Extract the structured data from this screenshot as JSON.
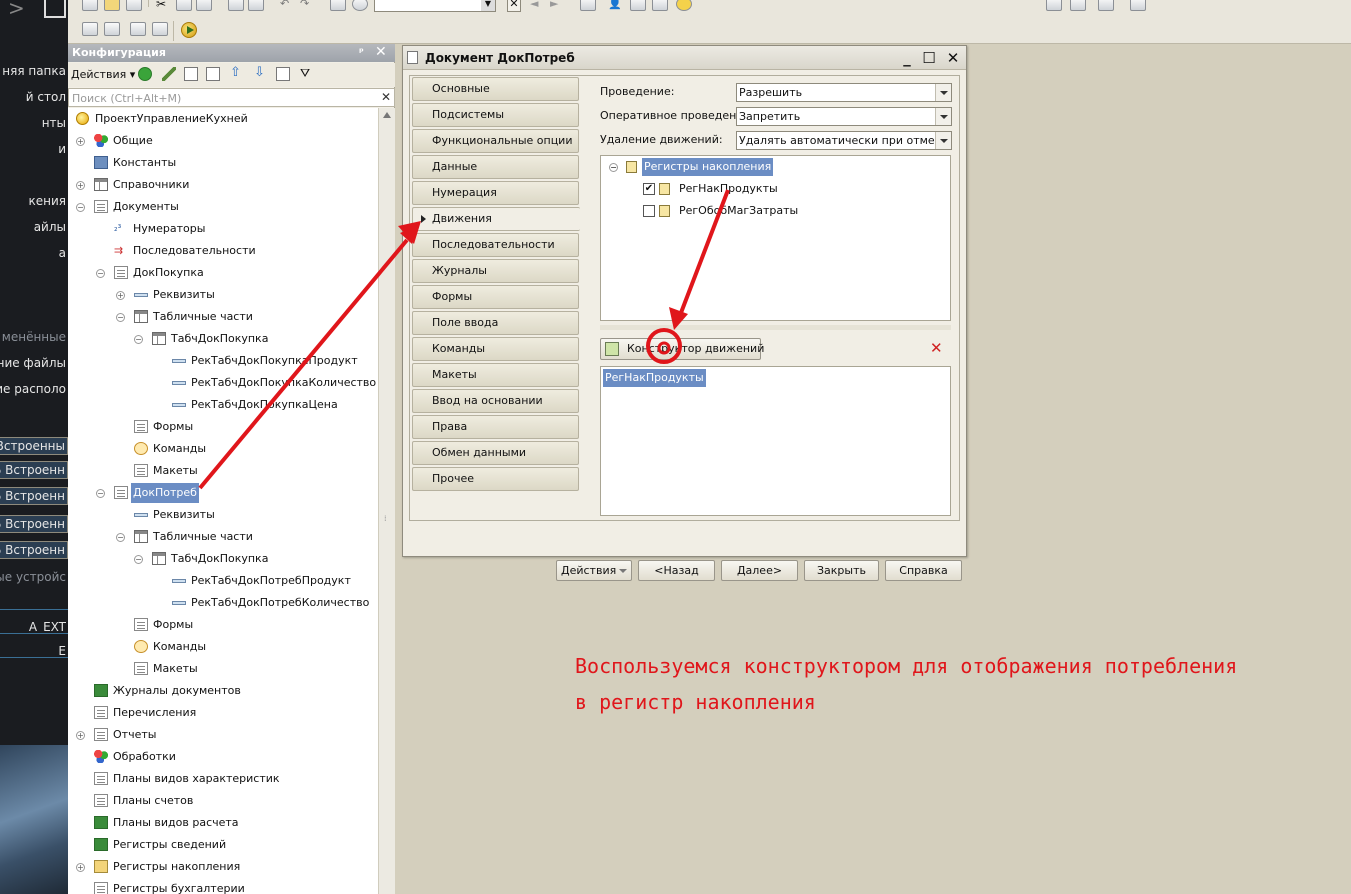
{
  "desktop": {
    "items": [
      {
        "text": "няя папка",
        "dim": false
      },
      {
        "text": "й стол",
        "dim": false
      },
      {
        "text": "нты",
        "dim": false
      },
      {
        "text": "и",
        "dim": false
      },
      {
        "text": "кения",
        "dim": false
      },
      {
        "text": "айлы",
        "dim": false
      },
      {
        "text": "а",
        "dim": false
      },
      {
        "text": "менённые",
        "dim": true
      },
      {
        "text": "ние файлы",
        "dim": false
      },
      {
        "text": "ние располо",
        "dim": false
      },
      {
        "text": "Встроенны",
        "dim": false
      },
      {
        "text": "Б Встроенн",
        "dim": false
      },
      {
        "text": "Б Встроенн",
        "dim": false
      },
      {
        "text": "Б Встроенн",
        "dim": false
      },
      {
        "text": "Б Встроенн",
        "dim": false
      },
      {
        "text": "ные устройс",
        "dim": true
      },
      {
        "text": "A_EXT",
        "dim": false
      },
      {
        "text": "E",
        "dim": false
      }
    ]
  },
  "config_panel": {
    "title": "Конфигурация",
    "actions_label": "Действия",
    "search_placeholder": "Поиск (Ctrl+Alt+M)",
    "tree": [
      "ПроектУправлениеКухней",
      "Общие",
      "Константы",
      "Справочники",
      "Документы",
      "Нумераторы",
      "Последовательности",
      "ДокПокупка",
      "Реквизиты",
      "Табличные части",
      "ТабчДокПокупка",
      "РекТабчДокПокупкаПродукт",
      "РекТабчДокПокупкаКоличество",
      "РекТабчДокПокупкаЦена",
      "Формы",
      "Команды",
      "Макеты",
      "ДокПотреб",
      "Реквизиты",
      "Табличные части",
      "ТабчДокПокупка",
      "РекТабчДокПотребПродукт",
      "РекТабчДокПотребКоличество",
      "Формы",
      "Команды",
      "Макеты",
      "Журналы документов",
      "Перечисления",
      "Отчеты",
      "Обработки",
      "Планы видов характеристик",
      "Планы счетов",
      "Планы видов расчета",
      "Регистры сведений",
      "Регистры накопления",
      "Регистры бухгалтерии"
    ]
  },
  "doc_window": {
    "title": "Документ ДокПотреб",
    "tabs": [
      "Основные",
      "Подсистемы",
      "Функциональные опции",
      "Данные",
      "Нумерация",
      "Движения",
      "Последовательности",
      "Журналы",
      "Формы",
      "Поле ввода",
      "Команды",
      "Макеты",
      "Ввод на основании",
      "Права",
      "Обмен данными",
      "Прочее"
    ],
    "active_tab_index": 5,
    "fields": [
      {
        "label": "Проведение:",
        "value": "Разрешить"
      },
      {
        "label": "Оперативное проведен...",
        "value": "Запретить"
      },
      {
        "label": "Удаление движений:",
        "value": "Удалять автоматически при отмене"
      }
    ],
    "reg_tree": {
      "root": "Регистры накопления",
      "items": [
        {
          "label": "РегНакПродукты",
          "checked": true
        },
        {
          "label": "РегОбобМагЗатраты",
          "checked": false
        }
      ]
    },
    "constructor_button": "Конструктор движений",
    "movements": [
      "РегНакПродукты"
    ],
    "buttons": {
      "actions": "Действия",
      "back": "<Назад",
      "next": "Далее>",
      "close": "Закрыть",
      "help": "Справка"
    }
  },
  "annotation": {
    "line1": "Воспользуемся конструктором для отображения потребления",
    "line2": "в регистр накопления",
    "color": "#e0161b"
  }
}
